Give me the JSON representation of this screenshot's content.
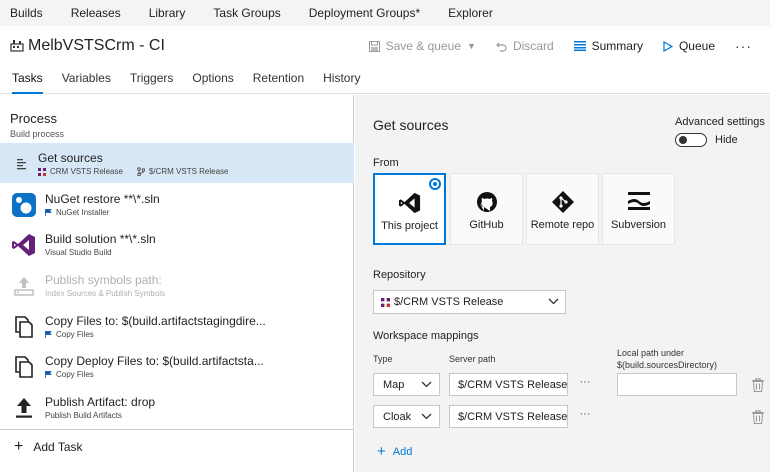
{
  "topnav": [
    "Builds",
    "Releases",
    "Library",
    "Task Groups",
    "Deployment Groups*",
    "Explorer"
  ],
  "header": {
    "title": "MelbVSTSCrm - CI",
    "save_queue": "Save & queue",
    "discard": "Discard",
    "summary": "Summary",
    "queue": "Queue",
    "more": "···"
  },
  "tabs": [
    "Tasks",
    "Variables",
    "Triggers",
    "Options",
    "Retention",
    "History"
  ],
  "process": {
    "title": "Process",
    "subtitle": "Build process"
  },
  "tasks": [
    {
      "name": "Get sources",
      "sub1": "CRM VSTS Release",
      "sub2": "$/CRM VSTS Release",
      "icon": "get-sources-icon"
    },
    {
      "name": "NuGet restore **\\*.sln",
      "sub1": "NuGet Installer",
      "icon": "nuget-icon"
    },
    {
      "name": "Build solution **\\*.sln",
      "sub1": "Visual Studio Build",
      "icon": "visual-studio-icon"
    },
    {
      "name": "Publish symbols path:",
      "sub1": "Index Sources & Publish Symbols",
      "icon": "publish-symbols-icon"
    },
    {
      "name": "Copy Files to: $(build.artifactstagingdire...",
      "sub1": "Copy Files",
      "icon": "copy-files-icon"
    },
    {
      "name": "Copy Deploy Files to: $(build.artifactsta...",
      "sub1": "Copy Files",
      "icon": "copy-files-icon"
    },
    {
      "name": "Publish Artifact: drop",
      "sub1": "Publish Build Artifacts",
      "icon": "upload-icon"
    }
  ],
  "add_task": "Add Task",
  "get_sources": {
    "title": "Get sources",
    "advanced_settings": "Advanced settings",
    "hide": "Hide",
    "from": "From",
    "sources": [
      {
        "label": "This project",
        "icon": "visual-studio-icon"
      },
      {
        "label": "GitHub",
        "icon": "github-icon"
      },
      {
        "label": "Remote repo",
        "icon": "git-icon"
      },
      {
        "label": "Subversion",
        "icon": "subversion-icon"
      }
    ],
    "repository_label": "Repository",
    "repository_value": "$/CRM VSTS Release",
    "workspace_label": "Workspace mappings",
    "col_type": "Type",
    "col_server": "Server path",
    "col_local_1": "Local path under",
    "col_local_2": "$(build.sourcesDirectory)",
    "mappings": [
      {
        "type": "Map",
        "server": "$/CRM VSTS Release",
        "local": ""
      },
      {
        "type": "Cloak",
        "server": "$/CRM VSTS Release..",
        "local": ""
      }
    ],
    "ellipsis": "···",
    "add": "Add"
  },
  "colors": {
    "accent": "#0078d7",
    "selected_bg": "#d7e7f5",
    "vs_purple": "#68217a"
  }
}
